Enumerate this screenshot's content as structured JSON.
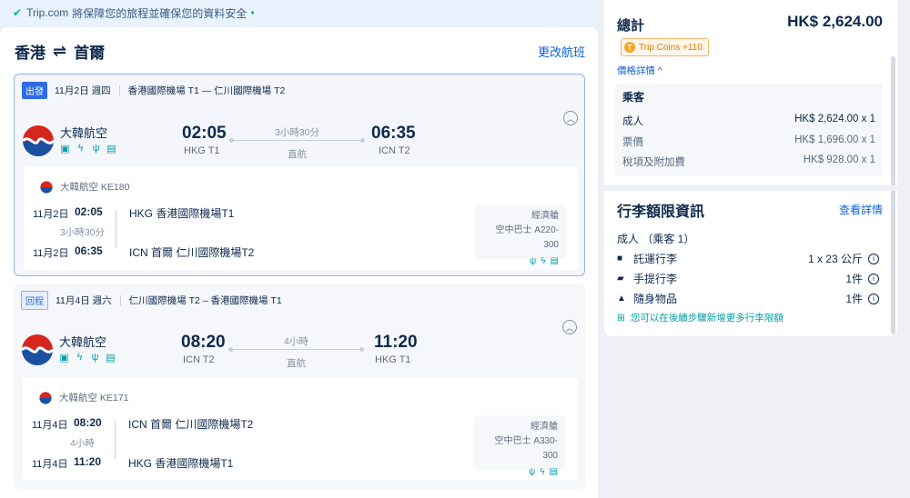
{
  "banner": {
    "brand": "Trip.com",
    "text": "將保障您的旅程並確保您的資料安全"
  },
  "route": {
    "from": "香港",
    "to": "首爾",
    "swap": "⇌",
    "change": "更改航班"
  },
  "outbound": {
    "tag": "出發",
    "date": "11月2日 週四",
    "airports": "香港國際機場 T1 — 仁川國際機場 T2",
    "airline": "大韓航空",
    "dep_time": "02:05",
    "dep_ap": "HKG T1",
    "duration": "3小時30分",
    "direct": "直航",
    "arr_time": "06:35",
    "arr_ap": "ICN T2",
    "detail": {
      "flight": "大韓航空 KE180",
      "dep_date": "11月2日",
      "dep_time": "02:05",
      "dep_port": "HKG 香港國際機場T1",
      "duration": "3小時30分",
      "arr_date": "11月2日",
      "arr_time": "06:35",
      "arr_port": "ICN 首爾 仁川國際機場T2",
      "cabin": "經濟艙",
      "aircraft": "空中巴士 A220-300"
    }
  },
  "inbound": {
    "tag": "回程",
    "date": "11月4日 週六",
    "airports": "仁川國際機場 T2 – 香港國際機場 T1",
    "airline": "大韓航空",
    "dep_time": "08:20",
    "dep_ap": "ICN T2",
    "duration": "4小時",
    "direct": "直航",
    "arr_time": "11:20",
    "arr_ap": "HKG T1",
    "detail": {
      "flight": "大韓航空 KE171",
      "dep_date": "11月4日",
      "dep_time": "08:20",
      "dep_port": "ICN 首爾 仁川國際機場T2",
      "duration": "4小時",
      "arr_date": "11月4日",
      "arr_time": "11:20",
      "arr_port": "HKG 香港國際機場T1",
      "cabin": "經濟艙",
      "aircraft": "空中巴士 A330-300"
    }
  },
  "summary": {
    "label": "總計",
    "total": "HK$ 2,624.00",
    "coins": "Trip Coins +110",
    "price_detail": "價格詳情 ^",
    "pax_title": "乘客",
    "rows": [
      {
        "label": "成人",
        "value": "HK$ 2,624.00 x 1"
      },
      {
        "label": "票價",
        "value": "HK$ 1,696.00 x 1"
      },
      {
        "label": "稅項及附加費",
        "value": "HK$ 928.00 x 1"
      }
    ]
  },
  "luggage": {
    "title": "行李額限資訊",
    "more": "查看詳情",
    "adult": "成人 （乘客 1）",
    "rows": [
      {
        "label": "託運行李",
        "value": "1 x 23 公斤"
      },
      {
        "label": "手提行李",
        "value": "1件"
      },
      {
        "label": "隨身物品",
        "value": "1件"
      }
    ],
    "note": "您可以在後續步驟新增更多行李限額"
  }
}
